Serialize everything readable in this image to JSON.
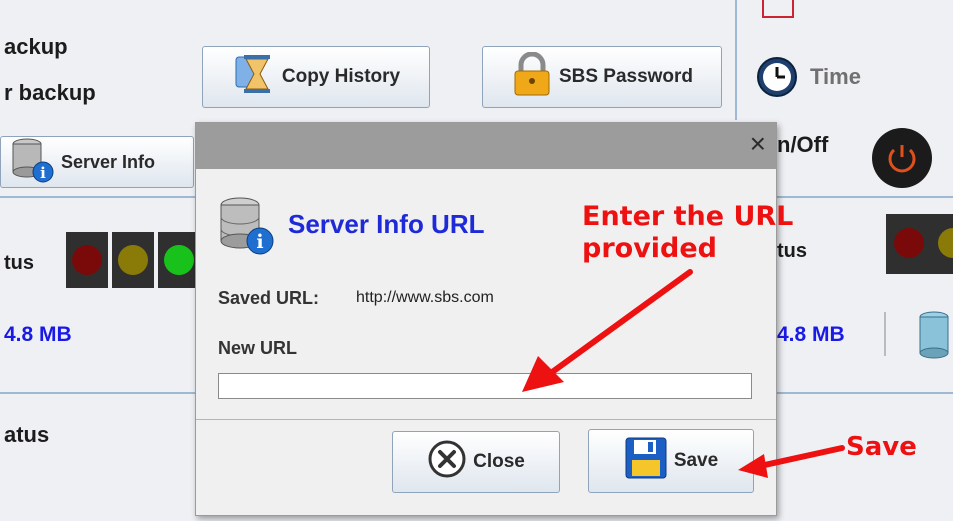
{
  "background": {
    "left_labels": [
      "ackup",
      "r backup",
      "tus",
      "atus"
    ],
    "left_size": "4.8 MB",
    "right_time_label": "Time",
    "right_onoff_label": "n/Off",
    "right_status_label": "tus",
    "right_size": "4.8 MB",
    "buttons": {
      "copy_history": "Copy History",
      "sbs_password": "SBS Password",
      "server_info": "Server Info"
    }
  },
  "dialog": {
    "close_glyph": "×",
    "title": "Server Info URL",
    "saved_url_label": "Saved URL:",
    "saved_url_value": "http://www.sbs.com",
    "new_url_label": "New URL",
    "new_url_value": "",
    "close_button": "Close",
    "save_button": "Save"
  },
  "annotations": {
    "enter_url": "Enter the URL provided",
    "save": "Save"
  },
  "colors": {
    "accent_blue": "#1e2ad8",
    "annotation_red": "#ee1111",
    "titlebar": "#9c9c9c"
  },
  "icons": [
    "database-info-icon",
    "hourglass-icon",
    "lock-icon",
    "clock-icon",
    "power-icon",
    "close-circle-icon",
    "floppy-save-icon",
    "traffic-light-icon",
    "database-icon"
  ]
}
